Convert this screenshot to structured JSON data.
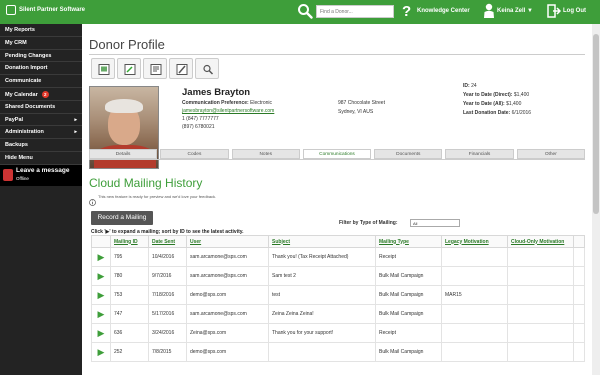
{
  "app": {
    "name": "Silent Partner Software",
    "search_placeholder": "Find a Donor...",
    "knowledge": "Knowledge Center",
    "user": "Keina Zell ▼",
    "logout": "Log Out"
  },
  "sidebar": {
    "items": [
      {
        "label": "My Reports"
      },
      {
        "label": "My CRM"
      },
      {
        "label": "Pending Changes"
      },
      {
        "label": "Donation Import"
      },
      {
        "label": "Communicate"
      },
      {
        "label": "My Calendar",
        "badge": "2"
      },
      {
        "label": "Shared Documents"
      },
      {
        "label": "PayPal",
        "arrow": "▸"
      },
      {
        "label": "Administration",
        "arrow": "▸"
      },
      {
        "label": "Backups"
      },
      {
        "label": "Hide Menu"
      }
    ],
    "chat": {
      "title": "Leave a message",
      "status": "Offline"
    }
  },
  "page": {
    "title": "Donor Profile"
  },
  "donor": {
    "name": "James Brayton",
    "pref_label": "Communication Preference:",
    "pref_value": "Electronic",
    "email": "jamesbrayton@silentpartnersoftware.com",
    "phone1": "1 (847) 7777777",
    "phone2": "(897) 6780021",
    "address1": "987 Chocolate Street",
    "address2": "Sydney, VI   AUS",
    "stats": [
      {
        "label": "ID:",
        "value": "24"
      },
      {
        "label": "Year to Date (Direct):",
        "value": "$1,400"
      },
      {
        "label": "Year to Date (All):",
        "value": "$1,400"
      },
      {
        "label": "Last Donation Date:",
        "value": "6/1/2016"
      }
    ]
  },
  "tabs": [
    "Details",
    "Codes",
    "Notes",
    "Communications",
    "Documents",
    "Financials",
    "Other"
  ],
  "active_tab": "Communications",
  "mailing": {
    "title": "Cloud Mailing History",
    "info": "This new feature is ready for preview and we'd love your feedback.",
    "record_button": "Record a Mailing",
    "filter_label": "Filter by Type of Mailing:",
    "filter_value": "All",
    "hint": "Click '▶' to expand a mailing; sort by ID to see the latest activity.",
    "columns": [
      "Mailing ID",
      "Date Sent",
      "User",
      "Subject",
      "Mailing Type",
      "Legacy Motivation",
      "Cloud-Only Motivation"
    ],
    "rows": [
      [
        "795",
        "10/4/2016",
        "sam.arcamone@sps.com",
        "Thank you! (Tax Receipt Attached)",
        "Receipt",
        "",
        ""
      ],
      [
        "780",
        "9/7/2016",
        "sam.arcamone@sps.com",
        "Sam test 2",
        "Bulk Mail Campaign",
        "",
        ""
      ],
      [
        "753",
        "7/18/2016",
        "demo@sps.com",
        "test",
        "Bulk Mail Campaign",
        "MAR15",
        ""
      ],
      [
        "747",
        "5/17/2016",
        "sam.arcamone@sps.com",
        "Zeina Zeina Zeina!",
        "Bulk Mail Campaign",
        "",
        ""
      ],
      [
        "636",
        "3/24/2016",
        "Zeina@sps.com",
        "Thank you for your support!",
        "Receipt",
        "",
        ""
      ],
      [
        "252",
        "7/8/2015",
        "demo@sps.com",
        "",
        "Bulk Mail Campaign",
        "",
        ""
      ]
    ]
  },
  "colors": {
    "brand": "#3e9e3a",
    "sidebar": "#232323",
    "badge": "#e0382a"
  }
}
